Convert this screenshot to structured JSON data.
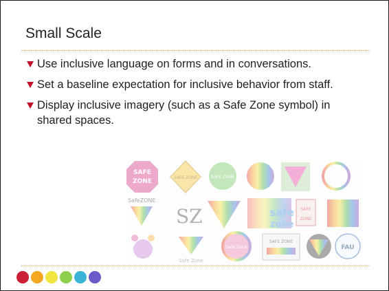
{
  "slide": {
    "title": "Small Scale",
    "bullets": [
      "Use inclusive language on forms and in conversations.",
      "Set a baseline expectation for inclusive behavior from staff.",
      "Display inclusive imagery (such as a Safe Zone symbol) in shared spaces."
    ]
  },
  "collage": {
    "labels": {
      "stop_sign_top": "SAFE",
      "stop_sign_bottom": "ZONE",
      "diamond": "SAFE ZONE",
      "circle_green": "SAFE ZONE",
      "safezone_text": "SafeZONE",
      "sz_logo": "SZ",
      "safe_word": "safe",
      "zone_word": "zone",
      "safe_small": "SAFE",
      "zone_small": "ZONE",
      "safe_zone_circle": "Safe Zone",
      "safe_zone_caption": "Safe Zone",
      "safe_zone_sign": "SAFE ZONE",
      "fau": "FAU"
    }
  },
  "footer": {
    "dot_colors": [
      "#cc1f36",
      "#f5a623",
      "#f1e542",
      "#8fd14f",
      "#3bb3d6",
      "#6a5bc9"
    ]
  },
  "colors": {
    "accent_rule": "#e8a23a",
    "bullet_marker": "#c0122c"
  }
}
